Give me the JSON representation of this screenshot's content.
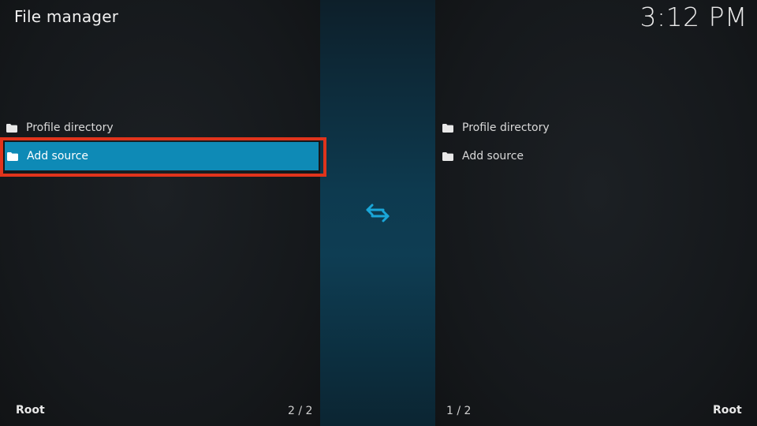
{
  "header": {
    "title": "File manager",
    "clock": "3:12 PM"
  },
  "left_pane": {
    "items": [
      {
        "label": "Profile directory",
        "icon": "folder-icon",
        "selected": false
      },
      {
        "label": "Add source",
        "icon": "folder-icon",
        "selected": true
      }
    ],
    "footer": {
      "path": "Root",
      "count": "2 / 2"
    }
  },
  "right_pane": {
    "items": [
      {
        "label": "Profile directory",
        "icon": "folder-icon",
        "selected": false
      },
      {
        "label": "Add source",
        "icon": "folder-icon",
        "selected": false
      }
    ],
    "footer": {
      "path": "Root",
      "count": "1 / 2"
    }
  },
  "center": {
    "icon": "swap-arrows-icon"
  },
  "colors": {
    "selection": "#0e8ab6",
    "focus_outline": "#e0341c",
    "accent_icon": "#1aa6d8"
  }
}
